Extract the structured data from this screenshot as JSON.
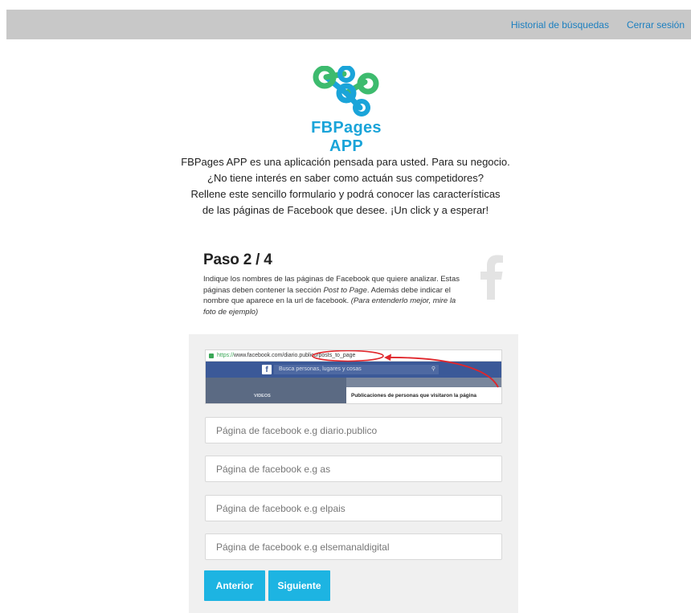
{
  "nav": {
    "history": "Historial de búsquedas",
    "logout": "Cerrar sesión"
  },
  "logo": {
    "text": "FBPages APP"
  },
  "intro": {
    "lines": [
      "FBPages APP es una aplicación pensada para usted. Para su negocio.",
      "¿No tiene interés en saber como actuán sus competidores?",
      "Rellene este sencillo formulario y podrá conocer las características",
      "de las páginas de Facebook que desee. ¡Un click y a esperar!"
    ]
  },
  "step": {
    "title": "Paso 2 / 4",
    "desc_part1": "Indique los nombres de las páginas de Facebook que quiere analizar. Estas páginas deben contener la sección ",
    "desc_em1": "Post to Page",
    "desc_part2": ". Además debe indicar el nombre que aparece en la url de facebook. ",
    "desc_em2": "(Para entenderlo mejor, mire la foto de ejemplo)"
  },
  "example": {
    "https": "https://",
    "host": "www.facebook.com/",
    "path": "diario.publico/posts_to_page",
    "search_placeholder": "Busca personas, lugares y cosas",
    "videos": "VIDEOS",
    "posts_section": "Publicaciones de personas que visitaron la página"
  },
  "form": {
    "fields": [
      {
        "placeholder": "Página de facebook e.g diario.publico",
        "value": ""
      },
      {
        "placeholder": "Página de facebook e.g as",
        "value": ""
      },
      {
        "placeholder": "Página de facebook e.g elpais",
        "value": ""
      },
      {
        "placeholder": "Página de facebook e.g elsemanaldigital",
        "value": ""
      }
    ],
    "prev_label": "Anterior",
    "next_label": "Siguiente"
  },
  "colors": {
    "accent": "#1db4e2",
    "link": "#1b7fc0",
    "topbar": "#c8c8c8",
    "panel": "#f0f0f0",
    "facebook": "#3b5998"
  },
  "icons": {
    "logo": "fbpages-logo-icon",
    "facebook": "facebook-f-icon",
    "lock": "lock-icon",
    "search": "search-icon"
  }
}
